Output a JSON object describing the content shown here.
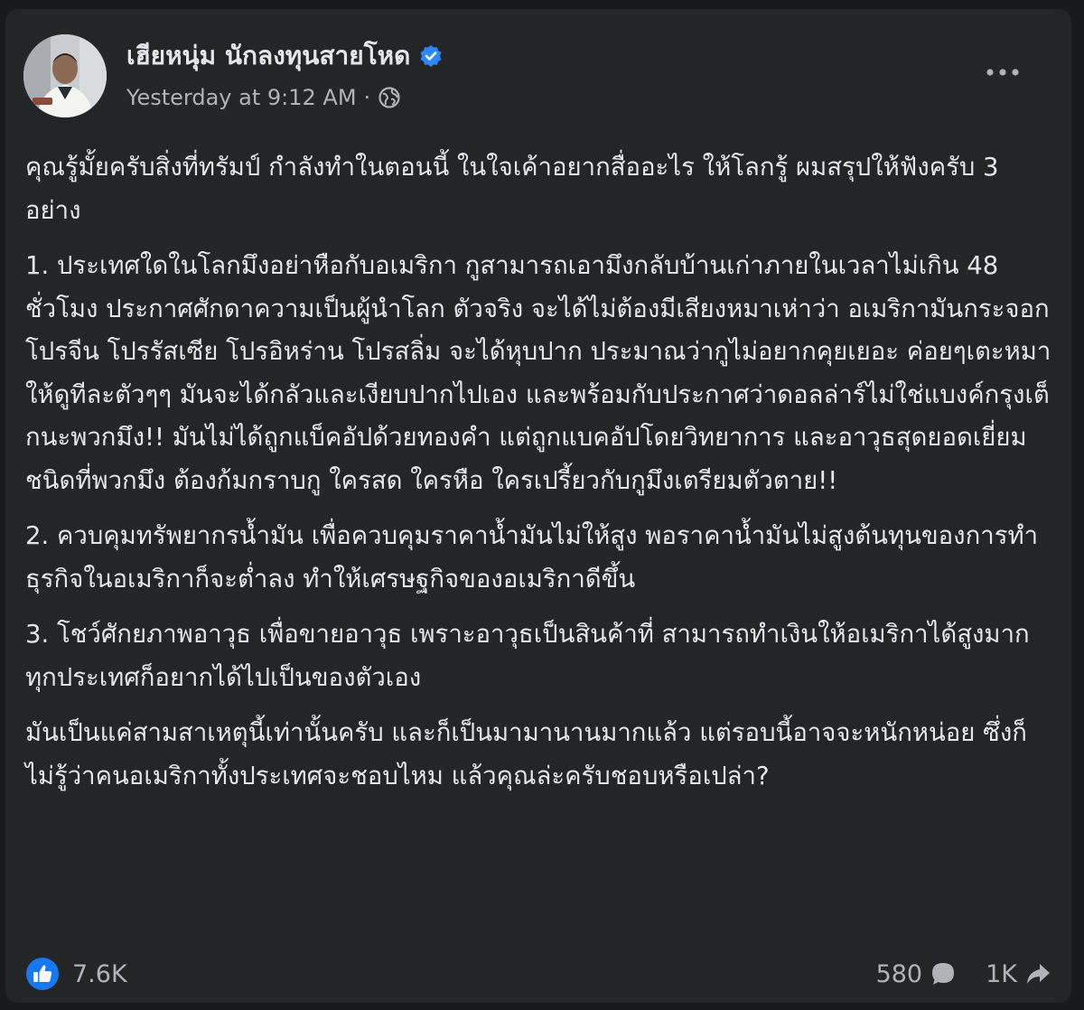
{
  "post": {
    "author": "เฮียหนุ่ม นักลงทุนสายโหด",
    "timestamp": "Yesterday at 9:12 AM",
    "separator": "·",
    "icons": {
      "verified": "verified-badge-icon",
      "audience": "globe-icon",
      "more": "more-options-icon",
      "like": "like-icon",
      "comment": "comment-icon",
      "share": "share-icon"
    },
    "colors": {
      "background": "#242526",
      "text": "#e4e6eb",
      "secondary_text": "#b0b3b8",
      "verified": "#2d88ff",
      "like": "#1877f2"
    },
    "paragraphs": [
      "คุณรู้มั้ยครับสิ่งที่ทรัมป์ กำลังทำในตอนนี้ ในใจเค้าอยากสื่ออะไร ให้โลกรู้ ผมสรุปให้ฟังครับ 3 อย่าง",
      "1. ประเทศใดในโลกมึงอย่าหือกับอเมริกา กูสามารถเอามึงกลับบ้านเก่าภายในเวลาไม่เกิน 48 ชั่วโมง ประกาศศักดาความเป็นผู้นำโลก ตัวจริง จะได้ไม่ต้องมีเสียงหมาเห่าว่า อเมริกามันกระจอก โปรจีน โปรรัสเซีย โปรอิหร่าน โปรสลิ่ม จะได้หุบปาก ประมาณว่ากูไม่อยากคุยเยอะ ค่อยๆเตะหมาให้ดูทีละตัวๆๆ มันจะได้กลัวและเงียบปากไปเอง และพร้อมกับประกาศว่าดอลล่าร์ไม่ใช่แบงค์กรุงเต็กนะพวกมึง!! มันไม่ได้ถูกแบ็คอัปด้วยทองคำ แต่ถูกแบคอัปโดยวิทยาการ และอาวุธสุดยอดเยี่ยม ชนิดที่พวกมึง ต้องก้มกราบกู ใครสด ใครหือ ใครเปรี้ยวกับกูมึงเตรียมตัวตาย!!",
      "2. ควบคุมทรัพยากรน้ำมัน เพื่อควบคุมราคาน้ำมันไม่ให้สูง พอราคาน้ำมันไม่สูงต้นทุนของการทำธุรกิจในอเมริกาก็จะต่ำลง ทำให้เศรษฐกิจของอเมริกาดีขึ้น",
      "3. โชว์ศักยภาพอาวุธ เพื่อขายอาวุธ เพราะอาวุธเป็นสินค้าที่ สามารถทำเงินให้อเมริกาได้สูงมาก ทุกประเทศก็อยากได้ไปเป็นของตัวเอง",
      "มันเป็นแค่สามสาเหตุนี้เท่านั้นครับ และก็เป็นมามานานมากแล้ว แต่รอบนี้อาจจะหนักหน่อย ซึ่งก็ไม่รู้ว่าคนอเมริกาทั้งประเทศจะชอบไหม แล้วคุณล่ะครับชอบหรือเปล่า?"
    ],
    "stats": {
      "reactions": "7.6K",
      "comments": "580",
      "shares": "1K"
    }
  }
}
